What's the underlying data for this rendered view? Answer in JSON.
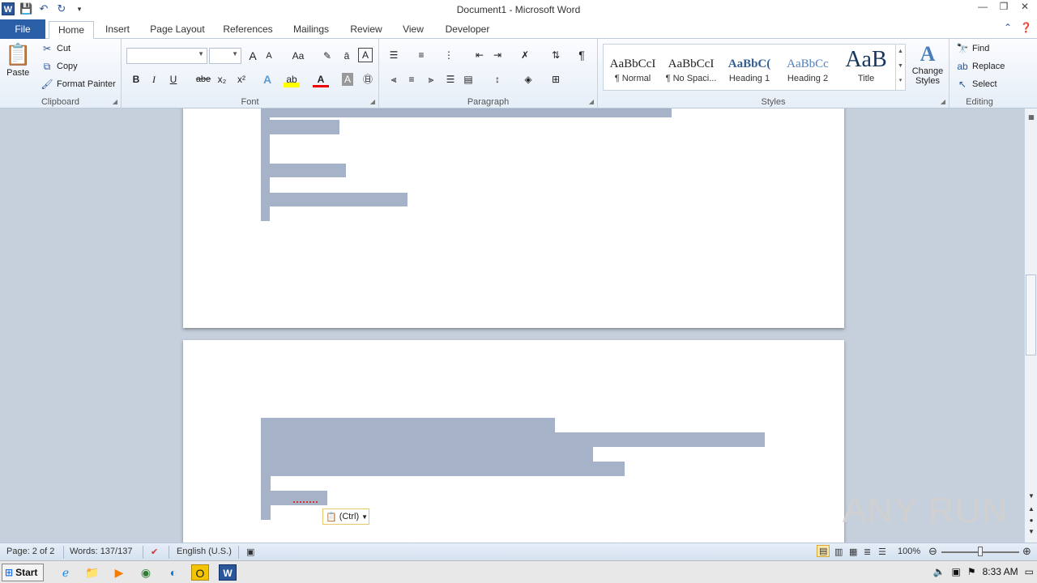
{
  "window": {
    "title": "Document1 - Microsoft Word",
    "controls": [
      "minimize-icon",
      "restore-icon",
      "close-icon"
    ]
  },
  "qat": {
    "icons": [
      "word-logo-icon",
      "save-icon",
      "undo-icon",
      "redo-icon",
      "customize-qat-icon"
    ],
    "logo_letter": "W"
  },
  "tabs": {
    "file": "File",
    "home": "Home",
    "insert": "Insert",
    "page_layout": "Page Layout",
    "references": "References",
    "mailings": "Mailings",
    "review": "Review",
    "view": "View",
    "developer": "Developer"
  },
  "clipboard": {
    "paste": "Paste",
    "cut": "Cut",
    "copy": "Copy",
    "format_painter": "Format Painter",
    "label": "Clipboard"
  },
  "font": {
    "font_name_value": "",
    "font_size_value": "",
    "bold": "B",
    "italic": "I",
    "underline": "U",
    "strikethrough": "abe",
    "subscript": "x₂",
    "superscript": "x²",
    "grow": "A",
    "shrink": "A",
    "change_case": "Aa",
    "label": "Font"
  },
  "paragraph": {
    "show_marks": "¶",
    "label": "Paragraph"
  },
  "styles": {
    "items": [
      {
        "sample": "AaBbCcI",
        "label": "¶ Normal"
      },
      {
        "sample": "AaBbCcI",
        "label": "¶ No Spaci..."
      },
      {
        "sample": "AaBbC(",
        "label": "Heading 1"
      },
      {
        "sample": "AaBbCc",
        "label": "Heading 2"
      },
      {
        "sample": "AaB",
        "label": "Title"
      }
    ],
    "change_styles": "Change Styles",
    "label": "Styles"
  },
  "editing": {
    "find": "Find",
    "replace": "Replace",
    "select": "Select",
    "label": "Editing"
  },
  "document": {
    "paste_options_label": "(Ctrl)"
  },
  "watermark": "ANY RUN",
  "status": {
    "page": "Page: 2 of 2",
    "words": "Words: 137/137",
    "language": "English (U.S.)",
    "zoom": "100%",
    "zoom_level": 1.0
  },
  "taskbar": {
    "start": "Start",
    "time": "8:33 AM",
    "apps": [
      "internet-explorer-icon",
      "file-explorer-icon",
      "media-player-icon",
      "chrome-icon",
      "edge-icon",
      "norton-icon",
      "word-icon"
    ]
  }
}
